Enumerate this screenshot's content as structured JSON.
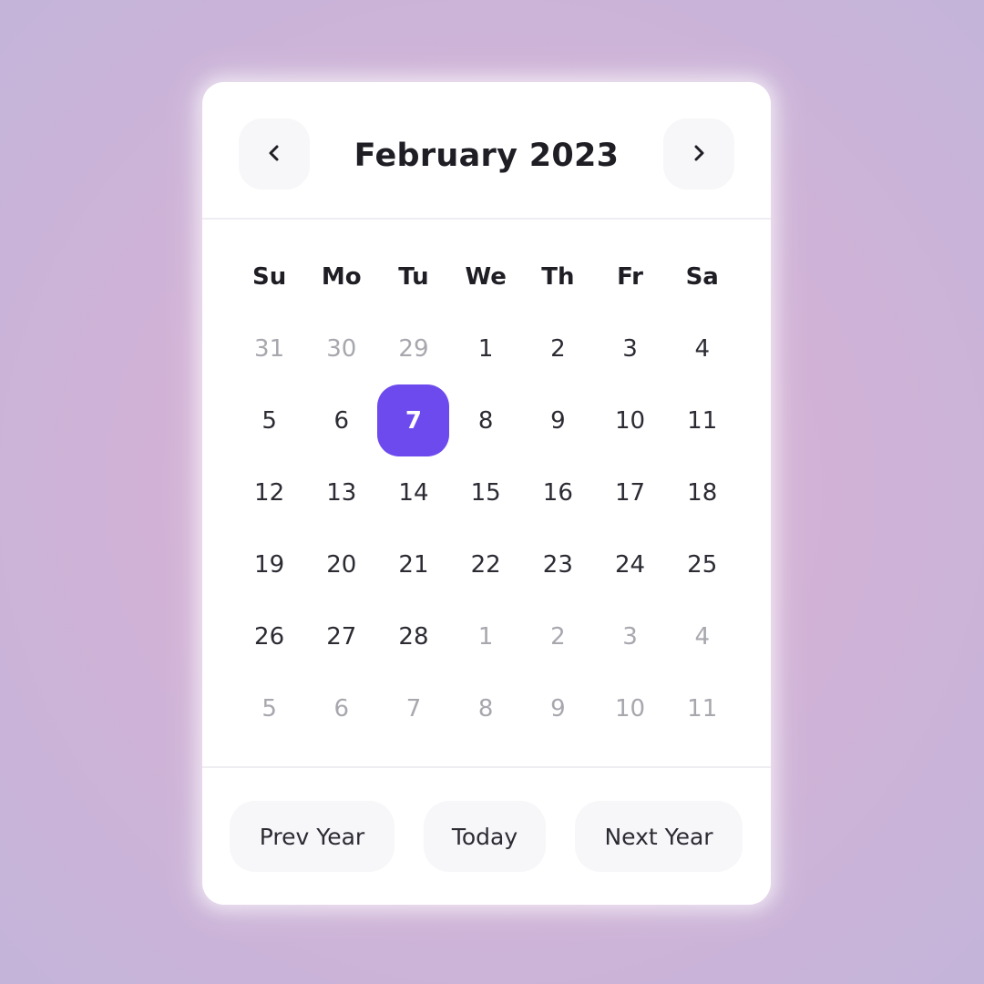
{
  "calendar": {
    "title": "February 2023",
    "prev_icon": "chevron-left-icon",
    "next_icon": "chevron-right-icon",
    "accent_color": "#6d4aed",
    "weekdays": [
      "Su",
      "Mo",
      "Tu",
      "We",
      "Th",
      "Fr",
      "Sa"
    ],
    "selected_day": "7",
    "weeks": [
      [
        {
          "d": "31",
          "muted": true
        },
        {
          "d": "30",
          "muted": true
        },
        {
          "d": "29",
          "muted": true
        },
        {
          "d": "1"
        },
        {
          "d": "2"
        },
        {
          "d": "3"
        },
        {
          "d": "4"
        }
      ],
      [
        {
          "d": "5"
        },
        {
          "d": "6"
        },
        {
          "d": "7",
          "selected": true
        },
        {
          "d": "8"
        },
        {
          "d": "9"
        },
        {
          "d": "10"
        },
        {
          "d": "11"
        }
      ],
      [
        {
          "d": "12"
        },
        {
          "d": "13"
        },
        {
          "d": "14"
        },
        {
          "d": "15"
        },
        {
          "d": "16"
        },
        {
          "d": "17"
        },
        {
          "d": "18"
        }
      ],
      [
        {
          "d": "19"
        },
        {
          "d": "20"
        },
        {
          "d": "21"
        },
        {
          "d": "22"
        },
        {
          "d": "23"
        },
        {
          "d": "24"
        },
        {
          "d": "25"
        }
      ],
      [
        {
          "d": "26"
        },
        {
          "d": "27"
        },
        {
          "d": "28"
        },
        {
          "d": "1",
          "muted": true
        },
        {
          "d": "2",
          "muted": true
        },
        {
          "d": "3",
          "muted": true
        },
        {
          "d": "4",
          "muted": true
        }
      ],
      [
        {
          "d": "5",
          "muted": true
        },
        {
          "d": "6",
          "muted": true
        },
        {
          "d": "7",
          "muted": true
        },
        {
          "d": "8",
          "muted": true
        },
        {
          "d": "9",
          "muted": true
        },
        {
          "d": "10",
          "muted": true
        },
        {
          "d": "11",
          "muted": true
        }
      ]
    ]
  },
  "footer": {
    "prev_year_label": "Prev Year",
    "today_label": "Today",
    "next_year_label": "Next Year"
  }
}
